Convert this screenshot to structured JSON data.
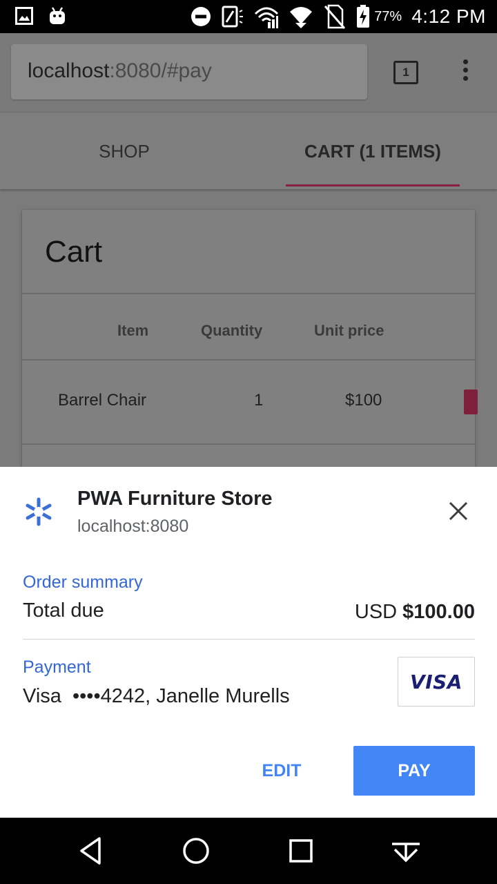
{
  "status_bar": {
    "battery": "77%",
    "time": "4:12 PM",
    "icons": [
      "image-icon",
      "android-icon",
      "do-not-disturb-icon",
      "nfc-icon",
      "signal-icon",
      "wifi-icon",
      "no-sim-icon",
      "battery-charging-icon"
    ]
  },
  "browser": {
    "url_host": "localhost",
    "url_rest": ":8080/#pay",
    "tab_count": "1"
  },
  "tabs": {
    "shop": "SHOP",
    "cart": "CART (1 ITEMS)"
  },
  "cart": {
    "title": "Cart",
    "columns": [
      "Item",
      "Quantity",
      "Unit price"
    ],
    "rows": [
      {
        "item": "Barrel Chair",
        "quantity": "1",
        "unit_price": "$100"
      }
    ]
  },
  "payment_sheet": {
    "merchant_name": "PWA Furniture Store",
    "merchant_origin": "localhost:8080",
    "order_summary_label": "Order summary",
    "total_label": "Total due",
    "total_currency": "USD",
    "total_value": "$100.00",
    "payment_label": "Payment",
    "payment_method": "Visa  ••••4242, Janelle Murells",
    "card_brand": "VISA",
    "edit_label": "EDIT",
    "pay_label": "PAY",
    "accent_color": "#4285f4"
  }
}
